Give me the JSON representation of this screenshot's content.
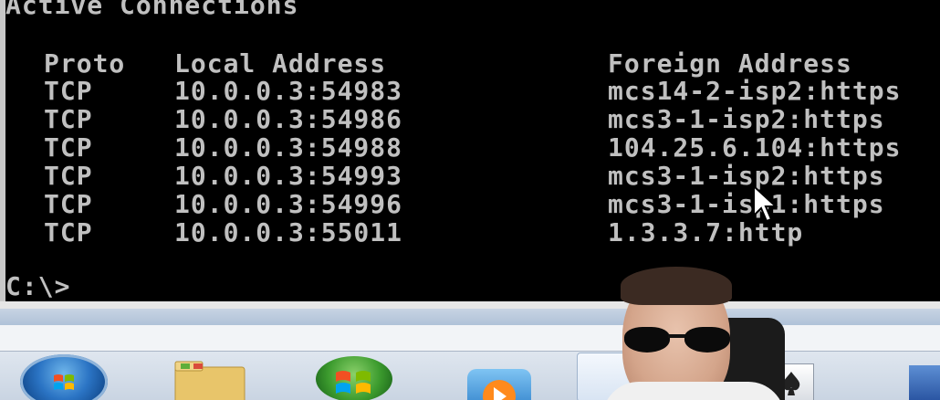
{
  "console": {
    "heading": "Active Connections",
    "columns": {
      "proto": "Proto",
      "local": "Local Address",
      "foreign": "Foreign Address"
    },
    "rows": [
      {
        "proto": "TCP",
        "local": "10.0.0.3:54983",
        "foreign": "mcs14-2-isp2:https"
      },
      {
        "proto": "TCP",
        "local": "10.0.0.3:54986",
        "foreign": "mcs3-1-isp2:https"
      },
      {
        "proto": "TCP",
        "local": "10.0.0.3:54988",
        "foreign": "104.25.6.104:https"
      },
      {
        "proto": "TCP",
        "local": "10.0.0.3:54993",
        "foreign": "mcs3-1-isp2:https"
      },
      {
        "proto": "TCP",
        "local": "10.0.0.3:54996",
        "foreign": "mcs3-1-isp1:https"
      },
      {
        "proto": "TCP",
        "local": "10.0.0.3:55011",
        "foreign": "1.3.3.7:http"
      }
    ],
    "prompt": "C:\\>"
  },
  "taskbar": {
    "icons": [
      "start-orb-icon",
      "folder-icon",
      "internet-explorer-icon",
      "media-player-icon",
      "solitaire-icon",
      "app-icon"
    ]
  },
  "colors": {
    "console_bg": "#000000",
    "console_text": "#c0c0c0",
    "taskbar": "#c9d4e2"
  }
}
